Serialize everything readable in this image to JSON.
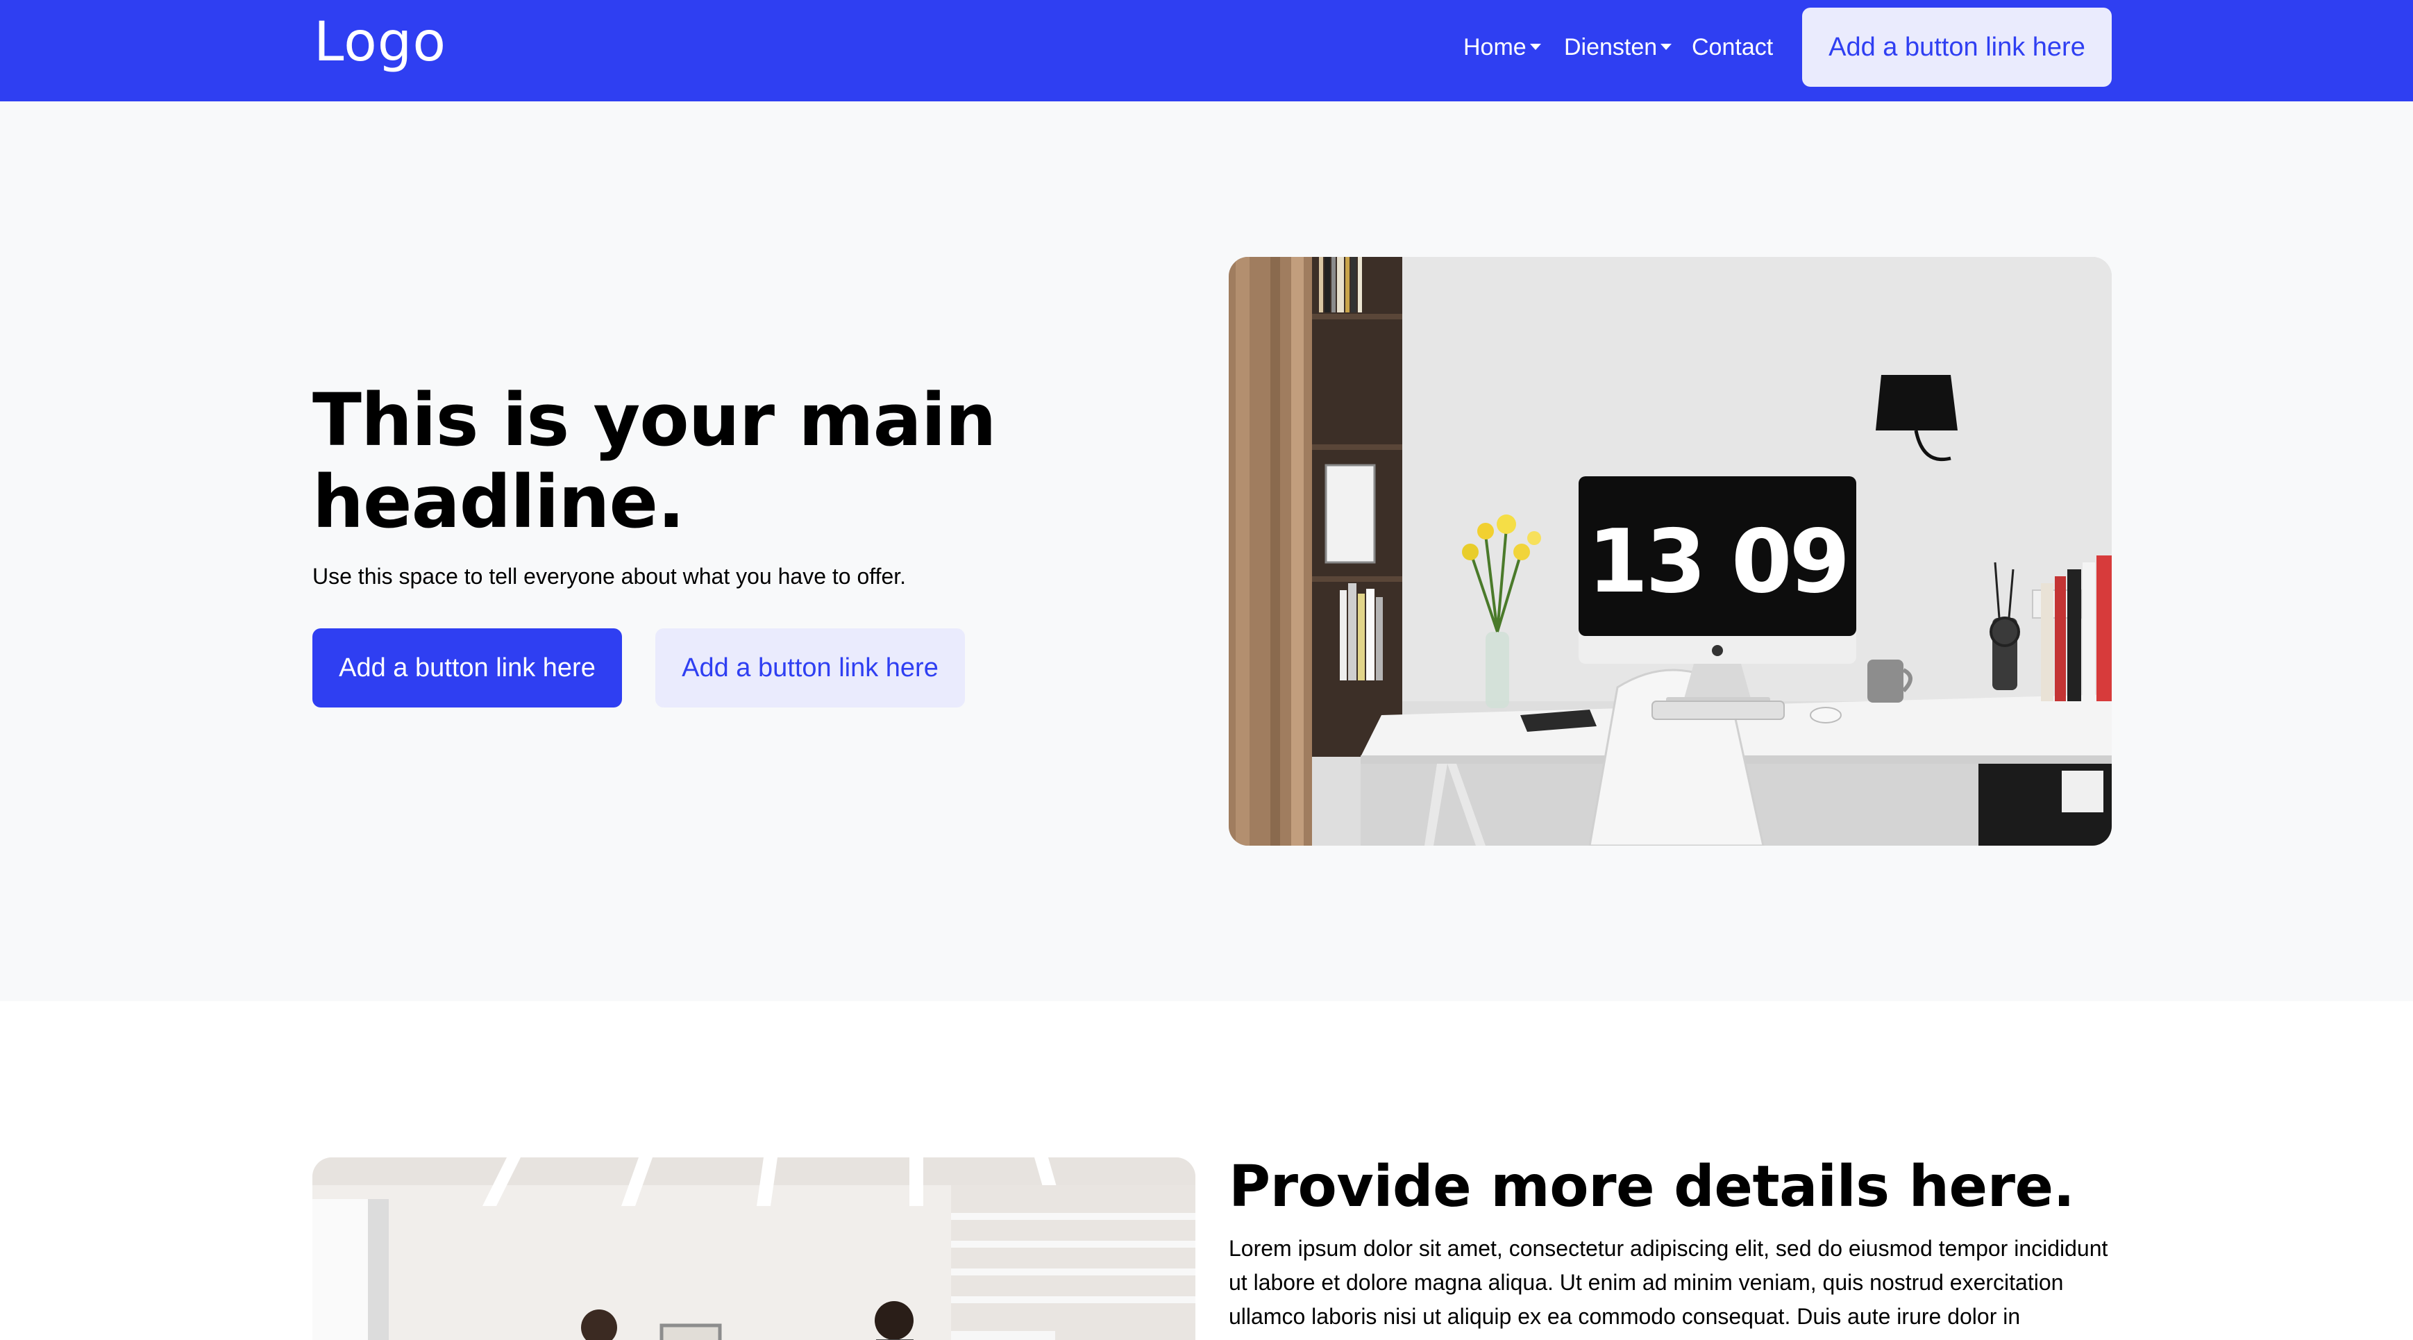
{
  "nav": {
    "logo": "Logo",
    "items": [
      {
        "label": "Home",
        "has_dropdown": true
      },
      {
        "label": "Diensten",
        "has_dropdown": true
      },
      {
        "label": "Contact",
        "has_dropdown": false
      }
    ],
    "cta_label": "Add a button link here"
  },
  "hero": {
    "title": "This is your main headline.",
    "subtitle": "Use this space to tell everyone about what you have to offer.",
    "primary_button": "Add a button link here",
    "secondary_button": "Add a button link here",
    "clock_text": "13 09"
  },
  "details": {
    "title": "Provide more details here.",
    "body": "Lorem ipsum dolor sit amet, consectetur adipiscing elit, sed do eiusmod tempor incididunt ut labore et dolore magna aliqua. Ut enim ad minim veniam, quis nostrud exercitation ullamco laboris nisi ut aliquip ex ea commodo consequat. Duis aute irure dolor in"
  },
  "colors": {
    "brand": "#2f3ff2",
    "brand_light": "#eaebfd",
    "hero_bg": "#f8f9fa",
    "text": "#000000"
  },
  "icons": [
    "chevron-down-icon",
    "apple-logo-icon"
  ]
}
